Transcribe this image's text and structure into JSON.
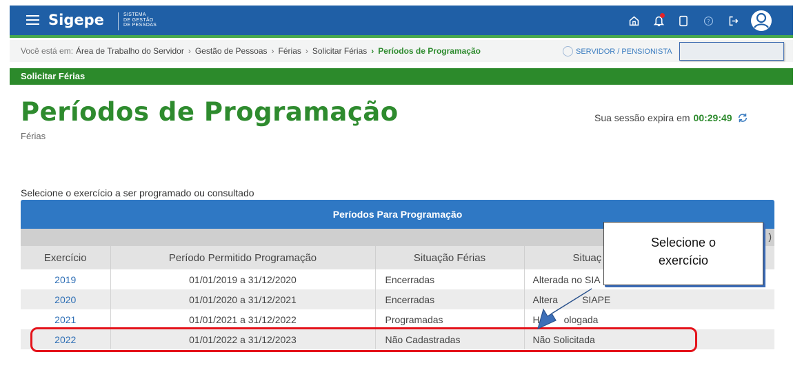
{
  "header": {
    "app_name": "Sigepe",
    "app_subtitle": [
      "SISTEMA",
      "DE GESTÃO",
      "DE PESSOAS"
    ],
    "icons": [
      "home-icon",
      "bell-icon",
      "document-icon",
      "help-icon",
      "logout-icon",
      "user-avatar-icon"
    ]
  },
  "breadcrumb": {
    "prefix": "Você está em:",
    "items": [
      "Área de Trabalho do Servidor",
      "Gestão de Pessoas",
      "Férias",
      "Solicitar Férias"
    ],
    "current": "Períodos de Programação",
    "role": "SERVIDOR / PENSIONISTA"
  },
  "section_bar": {
    "label": "Solicitar Férias"
  },
  "page": {
    "title": "Períodos de Programação",
    "subtitle": "Férias",
    "session_label": "Sua sessão expira em",
    "session_timer": "00:29:49",
    "instruction": "Selecione o exercício a ser programado ou consultado"
  },
  "table": {
    "title": "Períodos Para Programação",
    "filler_text": ")",
    "columns": [
      "Exercício",
      "Período Permitido Programação",
      "Situação Férias",
      "Situaç"
    ],
    "rows": [
      {
        "year": "2019",
        "period": "01/01/2019 a 31/12/2020",
        "situation": "Encerradas",
        "situation2": "Alterada no SIA"
      },
      {
        "year": "2020",
        "period": "01/01/2020 a 31/12/2021",
        "situation": "Encerradas",
        "situation2": "Altera         SIAPE"
      },
      {
        "year": "2021",
        "period": "01/01/2021 a 31/12/2022",
        "situation": "Programadas",
        "situation2": "H         ologada"
      },
      {
        "year": "2022",
        "period": "01/01/2022 a 31/12/2023",
        "situation": "Não Cadastradas",
        "situation2": "Não Solicitada"
      }
    ]
  },
  "annotation": {
    "callout_line1": "Selecione o",
    "callout_line2": "exercício",
    "highlight_color": "#e4131b",
    "arrow_color": "#3d6fb8"
  },
  "colors": {
    "header_blue": "#1f5fa6",
    "accent_green": "#2e8b2e",
    "table_head_blue": "#2f78c4"
  }
}
